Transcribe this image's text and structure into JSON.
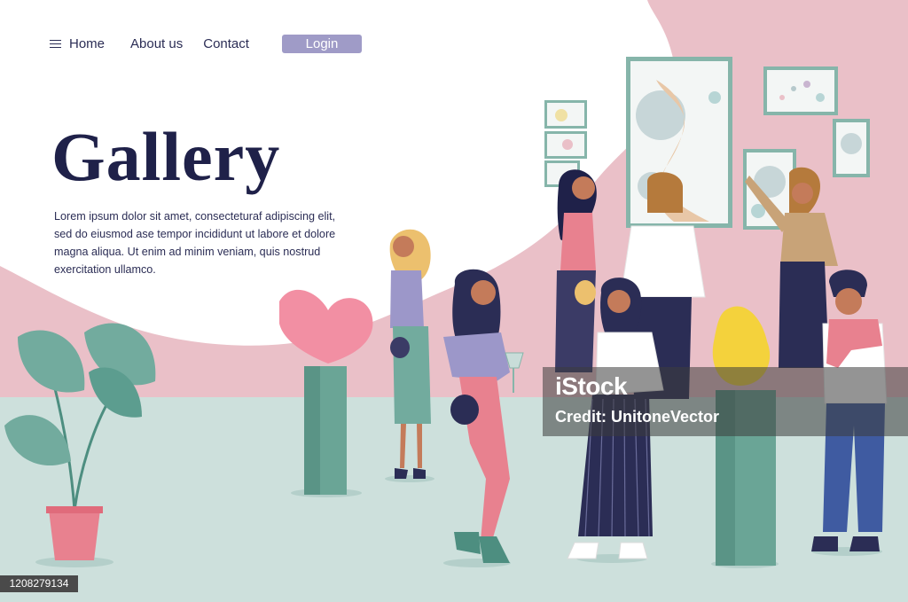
{
  "nav": {
    "home_label": "Home",
    "about_label": "About us",
    "contact_label": "Contact",
    "login_label": "Login",
    "menu_icon": "hamburger-menu-icon"
  },
  "hero": {
    "title": "Gallery",
    "body": "Lorem ipsum dolor sit amet, consecteturaf adipiscing elit, sed do eiusmod ase tempor incididunt ut labore et dolore magna aliqua. Ut enim ad minim veniam, quis nostrud exercitation ullamco."
  },
  "watermark": {
    "logo": "iStock",
    "credit": "Credit: UnitoneVector"
  },
  "stock_id": "1208279134",
  "colors": {
    "wall_pink": "#eac0c8",
    "floor": "#c9ddd9",
    "navy": "#2b2d55",
    "login_button": "#9f9bc7",
    "pedestal": "#6aa596"
  }
}
